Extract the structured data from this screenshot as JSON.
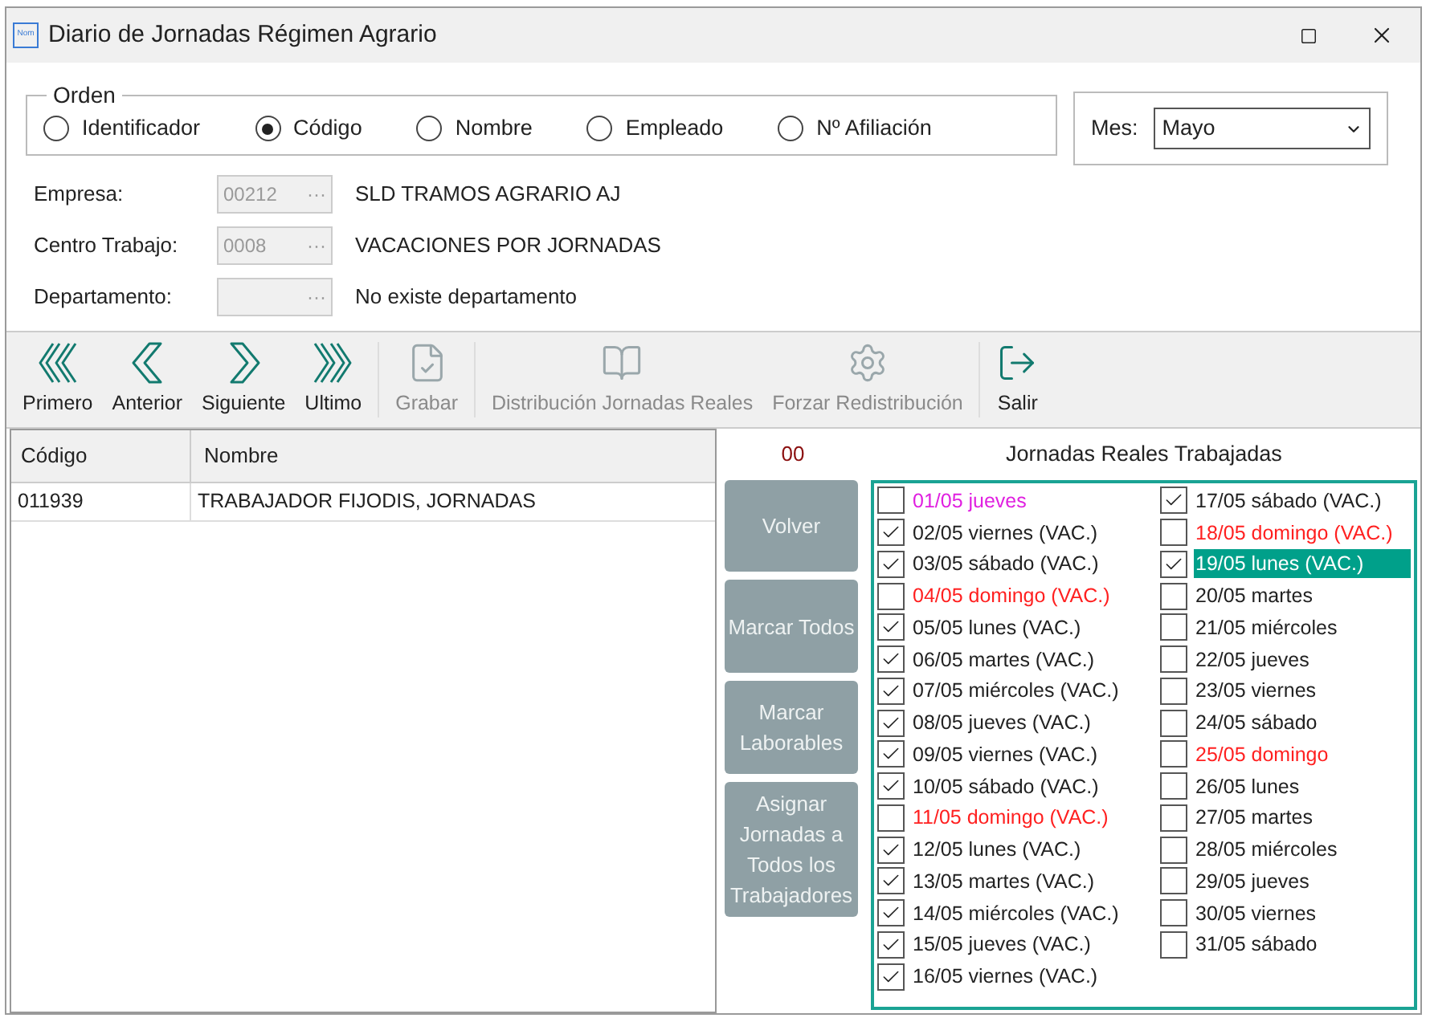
{
  "window": {
    "title": "Diario de Jornadas Régimen Agrario",
    "app_badge": "Nom"
  },
  "orden": {
    "legend": "Orden",
    "options": [
      {
        "label": "Identificador",
        "selected": false
      },
      {
        "label": "Código",
        "selected": true
      },
      {
        "label": "Nombre",
        "selected": false
      },
      {
        "label": "Empleado",
        "selected": false
      },
      {
        "label": "Nº Afiliación",
        "selected": false
      }
    ]
  },
  "mes": {
    "label": "Mes:",
    "value": "Mayo"
  },
  "fields": [
    {
      "label": "Empresa:",
      "code": "00212",
      "lookup": "···",
      "description": "SLD TRAMOS AGRARIO AJ"
    },
    {
      "label": "Centro Trabajo:",
      "code": "0008",
      "lookup": "···",
      "description": "VACACIONES POR JORNADAS"
    },
    {
      "label": "Departamento:",
      "lookup": "···",
      "description": "No existe departamento"
    }
  ],
  "toolbar": [
    {
      "label": "Primero",
      "kind": "first",
      "disabled": false
    },
    {
      "label": "Anterior",
      "kind": "prev",
      "disabled": false
    },
    {
      "label": "Siguiente",
      "kind": "next",
      "disabled": false
    },
    {
      "label": "Ultimo",
      "kind": "last",
      "disabled": false
    },
    {
      "label": "Grabar",
      "kind": "save",
      "disabled": true
    },
    {
      "label": "Distribución Jornadas Reales",
      "kind": "book",
      "disabled": true
    },
    {
      "label": "Forzar Redistribución",
      "kind": "gear",
      "disabled": true
    },
    {
      "label": "Salir",
      "kind": "exit",
      "disabled": false
    }
  ],
  "table": {
    "columns": [
      "Código",
      "Nombre"
    ],
    "rows": [
      {
        "codigo": "011939",
        "nombre": "TRABAJADOR FIJODIS, JORNADAS"
      }
    ]
  },
  "count": "00",
  "actions": [
    "Volver",
    "Marcar Todos",
    "Marcar Laborables",
    "Asignar Jornadas a Todos los Trabajadores"
  ],
  "jornadas": {
    "title": "Jornadas Reales Trabajadas",
    "columns": [
      {
        "days": [
          {
            "label": "01/05 jueves",
            "checked": false,
            "selected": false,
            "color": "#e020e0"
          },
          {
            "label": "02/05 viernes (VAC.)",
            "checked": true,
            "selected": false,
            "color": "#222222"
          },
          {
            "label": "03/05 sábado (VAC.)",
            "checked": true,
            "selected": false,
            "color": "#222222"
          },
          {
            "label": "04/05 domingo (VAC.)",
            "checked": false,
            "selected": false,
            "color": "#ff2020"
          },
          {
            "label": "05/05 lunes (VAC.)",
            "checked": true,
            "selected": false,
            "color": "#222222"
          },
          {
            "label": "06/05 martes (VAC.)",
            "checked": true,
            "selected": false,
            "color": "#222222"
          },
          {
            "label": "07/05 miércoles (VAC.)",
            "checked": true,
            "selected": false,
            "color": "#222222"
          },
          {
            "label": "08/05 jueves (VAC.)",
            "checked": true,
            "selected": false,
            "color": "#222222"
          },
          {
            "label": "09/05 viernes (VAC.)",
            "checked": true,
            "selected": false,
            "color": "#222222"
          },
          {
            "label": "10/05 sábado (VAC.)",
            "checked": true,
            "selected": false,
            "color": "#222222"
          },
          {
            "label": "11/05 domingo (VAC.)",
            "checked": false,
            "selected": false,
            "color": "#ff2020"
          },
          {
            "label": "12/05 lunes (VAC.)",
            "checked": true,
            "selected": false,
            "color": "#222222"
          },
          {
            "label": "13/05 martes (VAC.)",
            "checked": true,
            "selected": false,
            "color": "#222222"
          },
          {
            "label": "14/05 miércoles (VAC.)",
            "checked": true,
            "selected": false,
            "color": "#222222"
          },
          {
            "label": "15/05 jueves (VAC.)",
            "checked": true,
            "selected": false,
            "color": "#222222"
          },
          {
            "label": "16/05 viernes (VAC.)",
            "checked": true,
            "selected": false,
            "color": "#222222"
          }
        ]
      },
      {
        "days": [
          {
            "label": "17/05 sábado (VAC.)",
            "checked": true,
            "selected": false,
            "color": "#222222"
          },
          {
            "label": "18/05 domingo (VAC.)",
            "checked": false,
            "selected": false,
            "color": "#ff2020"
          },
          {
            "label": "19/05 lunes (VAC.)",
            "checked": true,
            "selected": true
          },
          {
            "label": "20/05 martes",
            "checked": false,
            "selected": false,
            "color": "#222222"
          },
          {
            "label": "21/05 miércoles",
            "checked": false,
            "selected": false,
            "color": "#222222"
          },
          {
            "label": "22/05 jueves",
            "checked": false,
            "selected": false,
            "color": "#222222"
          },
          {
            "label": "23/05 viernes",
            "checked": false,
            "selected": false,
            "color": "#222222"
          },
          {
            "label": "24/05 sábado",
            "checked": false,
            "selected": false,
            "color": "#222222"
          },
          {
            "label": "25/05 domingo",
            "checked": false,
            "selected": false,
            "color": "#ff2020"
          },
          {
            "label": "26/05 lunes",
            "checked": false,
            "selected": false,
            "color": "#222222"
          },
          {
            "label": "27/05 martes",
            "checked": false,
            "selected": false,
            "color": "#222222"
          },
          {
            "label": "28/05 miércoles",
            "checked": false,
            "selected": false,
            "color": "#222222"
          },
          {
            "label": "29/05 jueves",
            "checked": false,
            "selected": false,
            "color": "#222222"
          },
          {
            "label": "30/05 viernes",
            "checked": false,
            "selected": false,
            "color": "#222222"
          },
          {
            "label": "31/05 sábado",
            "checked": false,
            "selected": false,
            "color": "#222222"
          }
        ]
      }
    ]
  }
}
